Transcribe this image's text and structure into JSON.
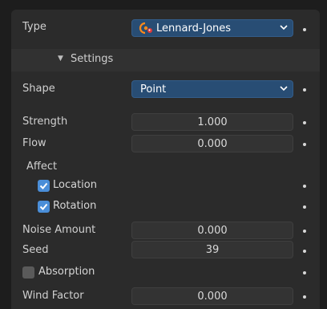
{
  "type_row": {
    "label": "Type",
    "value": "Lennard-Jones",
    "icon": "magnet-orbit-icon"
  },
  "settings_header": {
    "label": "Settings"
  },
  "shape_row": {
    "label": "Shape",
    "value": "Point"
  },
  "strength": {
    "label": "Strength",
    "value": "1.000"
  },
  "flow": {
    "label": "Flow",
    "value": "0.000"
  },
  "affect": {
    "label": "Affect",
    "location": {
      "label": "Location",
      "checked": true
    },
    "rotation": {
      "label": "Rotation",
      "checked": true
    }
  },
  "noise_amount": {
    "label": "Noise Amount",
    "value": "0.000"
  },
  "seed": {
    "label": "Seed",
    "value": "39"
  },
  "absorption": {
    "label": "Absorption",
    "checked": false
  },
  "wind_factor": {
    "label": "Wind Factor",
    "value": "0.000"
  },
  "colors": {
    "accent": "#4a8ed8",
    "dropdown_bg": "#284d74",
    "panel_bg": "#2b2b2b",
    "field_bg": "#333333"
  }
}
